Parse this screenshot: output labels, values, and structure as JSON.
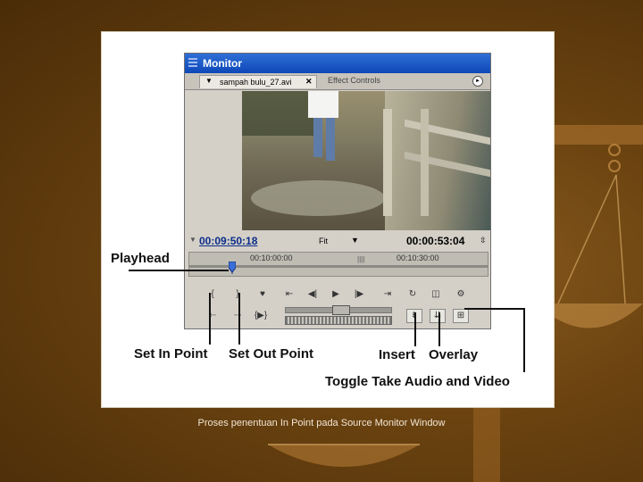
{
  "slide": {
    "caption": "Proses penentuan In Point pada Source Monitor Window"
  },
  "monitor": {
    "title": "Monitor",
    "tab_clip": "sampah bulu_27.avi",
    "tab_close": "✕",
    "tab_effect": "Effect Controls",
    "menu_icon": "►",
    "current_timecode": "00:09:50:18",
    "zoom_value": "Fit",
    "zoom_arrow": "▼",
    "duration_timecode": "00:00:53:04",
    "ruler_left": "00:10:00:00",
    "ruler_right": "00:10:30:00",
    "ruler_ticks": "||||"
  },
  "controls": {
    "row1": [
      {
        "name": "set-in-point-button",
        "icon": "in-point-icon",
        "glyph": "{"
      },
      {
        "name": "set-out-point-button",
        "icon": "out-point-icon",
        "glyph": "}"
      },
      {
        "name": "set-marker-button",
        "icon": "marker-icon",
        "glyph": "♥"
      },
      {
        "name": "go-to-in-point-button",
        "icon": "go-to-in-icon",
        "glyph": "⇤"
      },
      {
        "name": "step-back-button",
        "icon": "step-back-icon",
        "glyph": "◀|"
      },
      {
        "name": "play-button",
        "icon": "play-icon",
        "glyph": "▶"
      },
      {
        "name": "step-forward-button",
        "icon": "step-forward-icon",
        "glyph": "|▶"
      },
      {
        "name": "go-to-out-point-button",
        "icon": "go-to-out-icon",
        "glyph": "⇥"
      },
      {
        "name": "loop-button",
        "icon": "loop-icon",
        "glyph": "↻"
      },
      {
        "name": "safe-margins-button",
        "icon": "safe-margins-icon",
        "glyph": "◫"
      },
      {
        "name": "output-button",
        "icon": "output-icon",
        "glyph": "⚙"
      }
    ],
    "row2": [
      {
        "name": "go-to-prev-marker-button",
        "icon": "prev-marker-icon",
        "glyph": "⇠"
      },
      {
        "name": "go-to-next-marker-button",
        "icon": "next-marker-icon",
        "glyph": "⇢"
      },
      {
        "name": "play-in-to-out-button",
        "icon": "play-in-out-icon",
        "glyph": "{▶}"
      },
      {
        "name": "insert-button",
        "icon": "insert-icon",
        "glyph": "⇟"
      },
      {
        "name": "overlay-button",
        "icon": "overlay-icon",
        "glyph": "⇊"
      },
      {
        "name": "toggle-take-av-button",
        "icon": "take-av-icon",
        "glyph": "⊞"
      }
    ]
  },
  "annotations": {
    "playhead": "Playhead",
    "set_in": "Set In Point",
    "set_out": "Set Out Point",
    "insert": "Insert",
    "overlay": "Overlay",
    "toggle_take": "Toggle Take Audio and Video"
  }
}
